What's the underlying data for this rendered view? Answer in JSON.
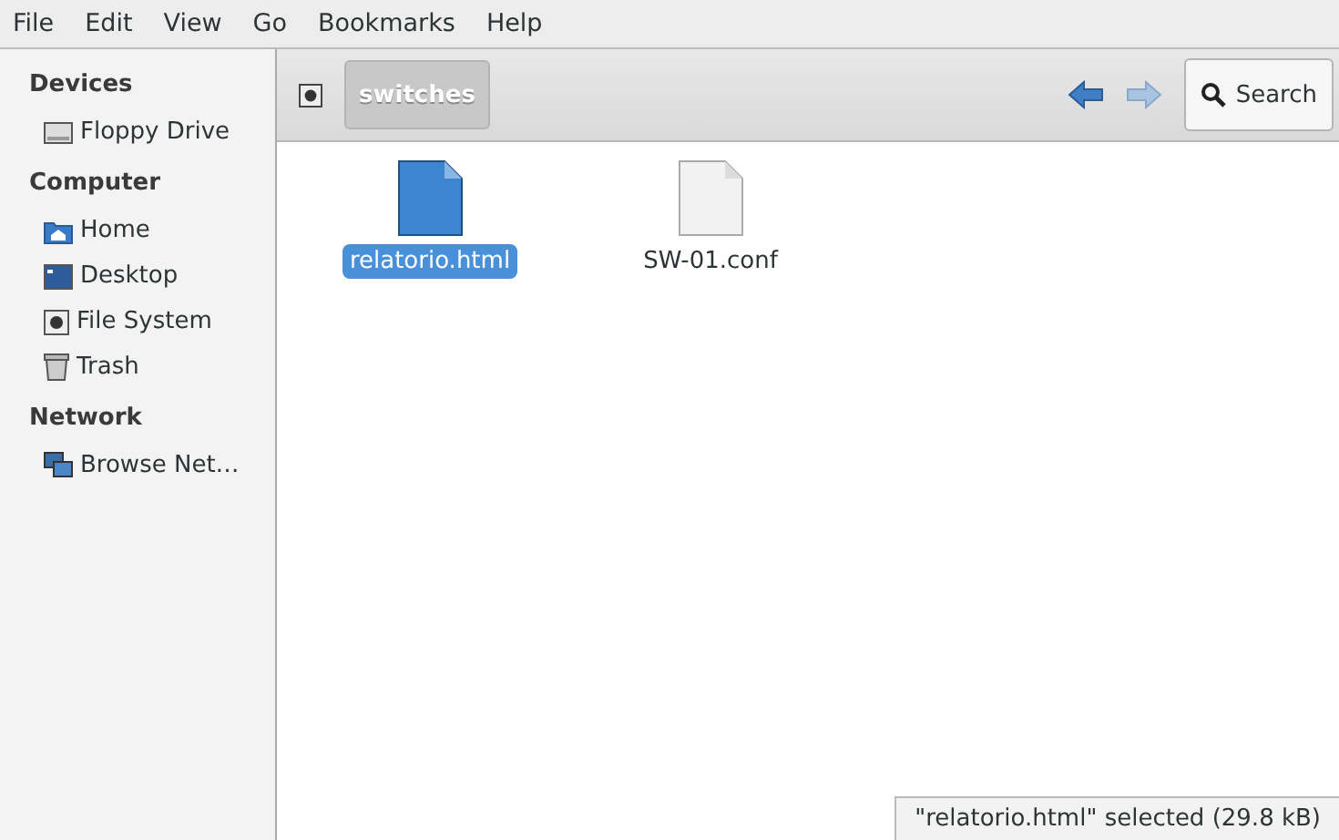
{
  "menu": [
    "File",
    "Edit",
    "View",
    "Go",
    "Bookmarks",
    "Help"
  ],
  "sidebar": [
    {
      "heading": "Devices",
      "items": [
        {
          "label": "Floppy Drive"
        }
      ]
    },
    {
      "heading": "Computer",
      "items": [
        {
          "label": "Home"
        },
        {
          "label": "Desktop"
        },
        {
          "label": "File System"
        },
        {
          "label": "Trash"
        }
      ]
    },
    {
      "heading": "Network",
      "items": [
        {
          "label": "Browse Net…"
        }
      ]
    }
  ],
  "path": {
    "label": "switches"
  },
  "nav": [
    {
      "kind": "back",
      "disabled": false
    },
    {
      "kind": "forward",
      "disabled": true
    }
  ],
  "search": {
    "label": "Search"
  },
  "files": [
    {
      "name": "relatorio.html",
      "kind": "html",
      "selected": true
    },
    {
      "name": "SW-01.conf",
      "kind": "plain",
      "selected": false
    }
  ],
  "status": "\"relatorio.html\" selected (29.8 kB)"
}
